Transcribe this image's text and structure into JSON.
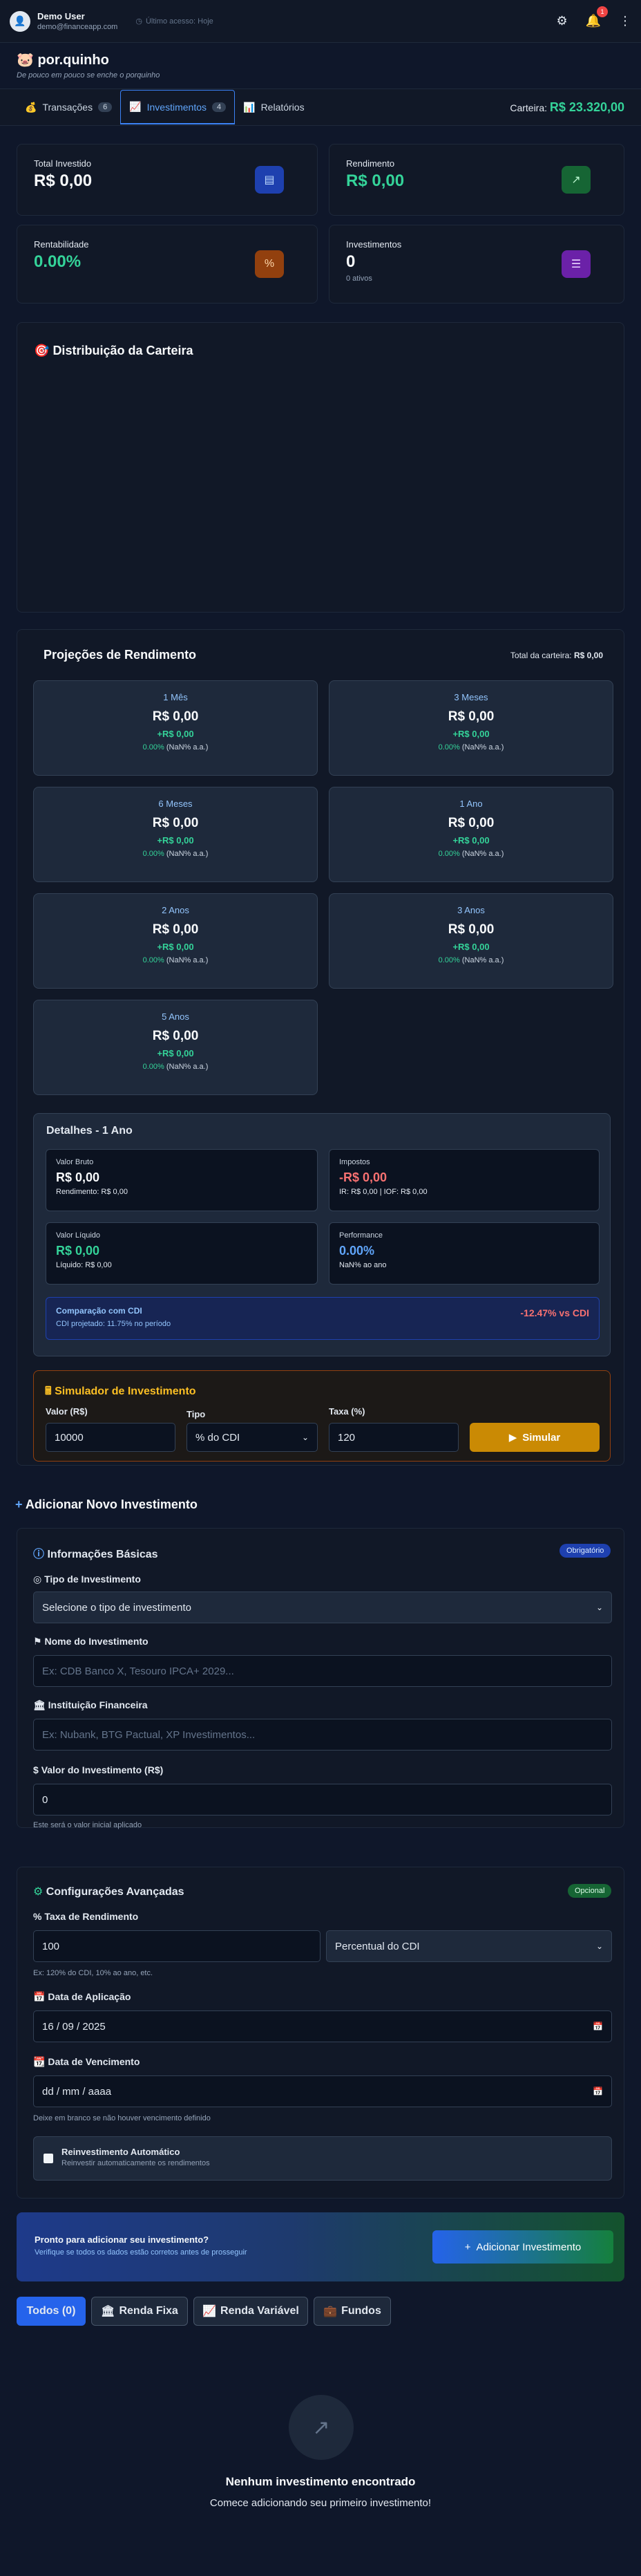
{
  "header": {
    "user_name": "Demo User",
    "user_email": "demo@financeapp.com",
    "last_access": "Último acesso: Hoje",
    "notification_count": "1"
  },
  "brand": {
    "title": "por.quinho",
    "slogan": "De pouco em pouco se enche o porquinho"
  },
  "tabs": [
    {
      "label": "Transações",
      "count": "6"
    },
    {
      "label": "Investimentos",
      "count": "4"
    },
    {
      "label": "Relatórios"
    }
  ],
  "wallet": {
    "label": "Carteira:",
    "value": "R$ 23.320,00"
  },
  "stats": {
    "total_investido": {
      "label": "Total Investido",
      "value": "R$ 0,00"
    },
    "rendimento": {
      "label": "Rendimento",
      "value": "R$ 0,00"
    },
    "rentabilidade": {
      "label": "Rentabilidade",
      "value": "0.00%"
    },
    "investimentos": {
      "label": "Investimentos",
      "value": "0",
      "sub": "0 ativos"
    }
  },
  "distribution": {
    "title": "Distribuição da Carteira"
  },
  "projections": {
    "title": "Projeções de Rendimento",
    "total_label": "Total da carteira:",
    "total_value": "R$ 0,00",
    "items": [
      {
        "label": "1 Mês",
        "value": "R$ 0,00",
        "gain": "+R$ 0,00",
        "pct": "0.00%",
        "annual": "(NaN% a.a.)"
      },
      {
        "label": "3 Meses",
        "value": "R$ 0,00",
        "gain": "+R$ 0,00",
        "pct": "0.00%",
        "annual": "(NaN% a.a.)"
      },
      {
        "label": "6 Meses",
        "value": "R$ 0,00",
        "gain": "+R$ 0,00",
        "pct": "0.00%",
        "annual": "(NaN% a.a.)"
      },
      {
        "label": "1 Ano",
        "value": "R$ 0,00",
        "gain": "+R$ 0,00",
        "pct": "0.00%",
        "annual": "(NaN% a.a.)"
      },
      {
        "label": "2 Anos",
        "value": "R$ 0,00",
        "gain": "+R$ 0,00",
        "pct": "0.00%",
        "annual": "(NaN% a.a.)"
      },
      {
        "label": "3 Anos",
        "value": "R$ 0,00",
        "gain": "+R$ 0,00",
        "pct": "0.00%",
        "annual": "(NaN% a.a.)"
      },
      {
        "label": "5 Anos",
        "value": "R$ 0,00",
        "gain": "+R$ 0,00",
        "pct": "0.00%",
        "annual": "(NaN% a.a.)"
      }
    ]
  },
  "details": {
    "title": "Detalhes - 1 Ano",
    "bruto": {
      "label": "Valor Bruto",
      "value": "R$ 0,00",
      "sub": "Rendimento: R$ 0,00"
    },
    "impostos": {
      "label": "Impostos",
      "value": "-R$ 0,00",
      "sub": "IR: R$ 0,00 | IOF: R$ 0,00"
    },
    "liquido": {
      "label": "Valor Líquido",
      "value": "R$ 0,00",
      "sub": "Líquido: R$ 0,00"
    },
    "performance": {
      "label": "Performance",
      "value": "0.00%",
      "sub": "NaN% ao ano"
    },
    "cdi": {
      "label": "Comparação com CDI",
      "sub": "CDI projetado: 11.75% no período",
      "value": "-12.47% vs CDI"
    }
  },
  "simulator": {
    "title": "Simulador de Investimento",
    "valor_label": "Valor (R$)",
    "valor": "10000",
    "tipo_label": "Tipo",
    "tipo": "% do CDI",
    "taxa_label": "Taxa (%)",
    "taxa": "120",
    "button": "Simular"
  },
  "new_investment": {
    "title": "Adicionar Novo Investimento",
    "basic": {
      "title": "Informações Básicas",
      "badge": "Obrigatório",
      "tipo_label": "Tipo de Investimento",
      "tipo_placeholder": "Selecione o tipo de investimento",
      "nome_label": "Nome do Investimento",
      "nome_placeholder": "Ex: CDB Banco X, Tesouro IPCA+ 2029...",
      "inst_label": "Instituição Financeira",
      "inst_placeholder": "Ex: Nubank, BTG Pactual, XP Investimentos...",
      "valor_label": "Valor do Investimento (R$)",
      "valor": "0",
      "valor_help": "Este será o valor inicial aplicado"
    },
    "advanced": {
      "title": "Configurações Avançadas",
      "badge": "Opcional",
      "taxa_label": "Taxa de Rendimento",
      "taxa": "100",
      "taxa_tipo": "Percentual do CDI",
      "taxa_help": "Ex: 120% do CDI, 10% ao ano, etc.",
      "aplicacao_label": "Data de Aplicação",
      "aplicacao": "16 / 09 / 2025",
      "vencimento_label": "Data de Vencimento",
      "vencimento": "dd / mm / aaaa",
      "vencimento_help": "Deixe em branco se não houver vencimento definido",
      "reinvest_label": "Reinvestimento Automático",
      "reinvest_help": "Reinvestir automaticamente os rendimentos"
    },
    "cta": {
      "title": "Pronto para adicionar seu investimento?",
      "sub": "Verifique se todos os dados estão corretos antes de prosseguir",
      "button": "Adicionar Investimento"
    }
  },
  "filters": [
    "Todos (0)",
    "Renda Fixa",
    "Renda Variável",
    "Fundos"
  ],
  "empty": {
    "title": "Nenhum investimento encontrado",
    "sub": "Comece adicionando seu primeiro investimento!"
  }
}
